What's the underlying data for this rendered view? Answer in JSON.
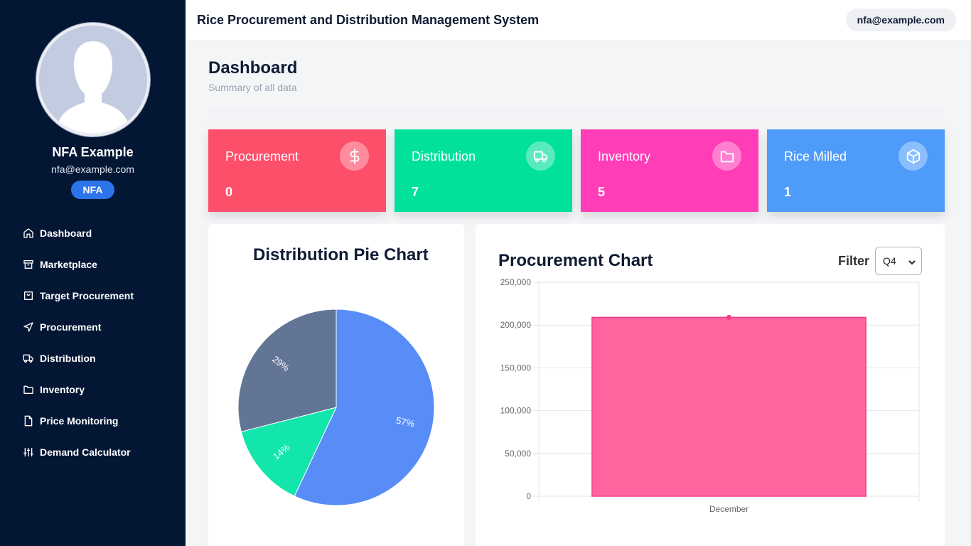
{
  "header": {
    "app_title": "Rice Procurement and Distribution Management System",
    "user_email": "nfa@example.com"
  },
  "sidebar": {
    "profile_name": "NFA Example",
    "profile_email": "nfa@example.com",
    "role": "NFA",
    "items": [
      {
        "label": "Dashboard",
        "icon": "home-icon"
      },
      {
        "label": "Marketplace",
        "icon": "archive-icon"
      },
      {
        "label": "Target Procurement",
        "icon": "shopping-bag-icon"
      },
      {
        "label": "Procurement",
        "icon": "send-icon"
      },
      {
        "label": "Distribution",
        "icon": "truck-icon"
      },
      {
        "label": "Inventory",
        "icon": "folder-icon"
      },
      {
        "label": "Price Monitoring",
        "icon": "file-icon"
      },
      {
        "label": "Demand Calculator",
        "icon": "sliders-icon"
      }
    ]
  },
  "page": {
    "title": "Dashboard",
    "subtitle": "Summary of all data"
  },
  "cards": [
    {
      "label": "Procurement",
      "value": "0",
      "icon": "dollar-icon",
      "color": "#fe4f6a"
    },
    {
      "label": "Distribution",
      "value": "7",
      "icon": "truck-icon",
      "color": "#01e19c"
    },
    {
      "label": "Inventory",
      "value": "5",
      "icon": "folder-icon",
      "color": "#ff3db7"
    },
    {
      "label": "Rice Milled",
      "value": "1",
      "icon": "box-icon",
      "color": "#4e9bfa"
    }
  ],
  "pie_panel": {
    "title": "Distribution Pie Chart"
  },
  "bar_panel": {
    "title": "Procurement Chart",
    "filter_label": "Filter",
    "filter_value": "Q4"
  },
  "colors": {
    "sidebar": "#031634",
    "accent": "#2c74ea",
    "bar": "#ff649f"
  },
  "chart_data": [
    {
      "type": "pie",
      "title": "Distribution Pie Chart",
      "slices": [
        {
          "value": 57,
          "label": "57%",
          "color": "#588cf6"
        },
        {
          "value": 14,
          "label": "14%",
          "color": "#12e6ac"
        },
        {
          "value": 29,
          "label": "29%",
          "color": "#627595"
        }
      ],
      "legend": "bottom"
    },
    {
      "type": "bar",
      "title": "Procurement Chart",
      "categories": [
        "December"
      ],
      "values": [
        209000
      ],
      "ylim": [
        0,
        250000
      ],
      "yticks": [
        "0",
        "50,000",
        "100,000",
        "150,000",
        "200,000",
        "250,000"
      ],
      "grid": true
    }
  ]
}
